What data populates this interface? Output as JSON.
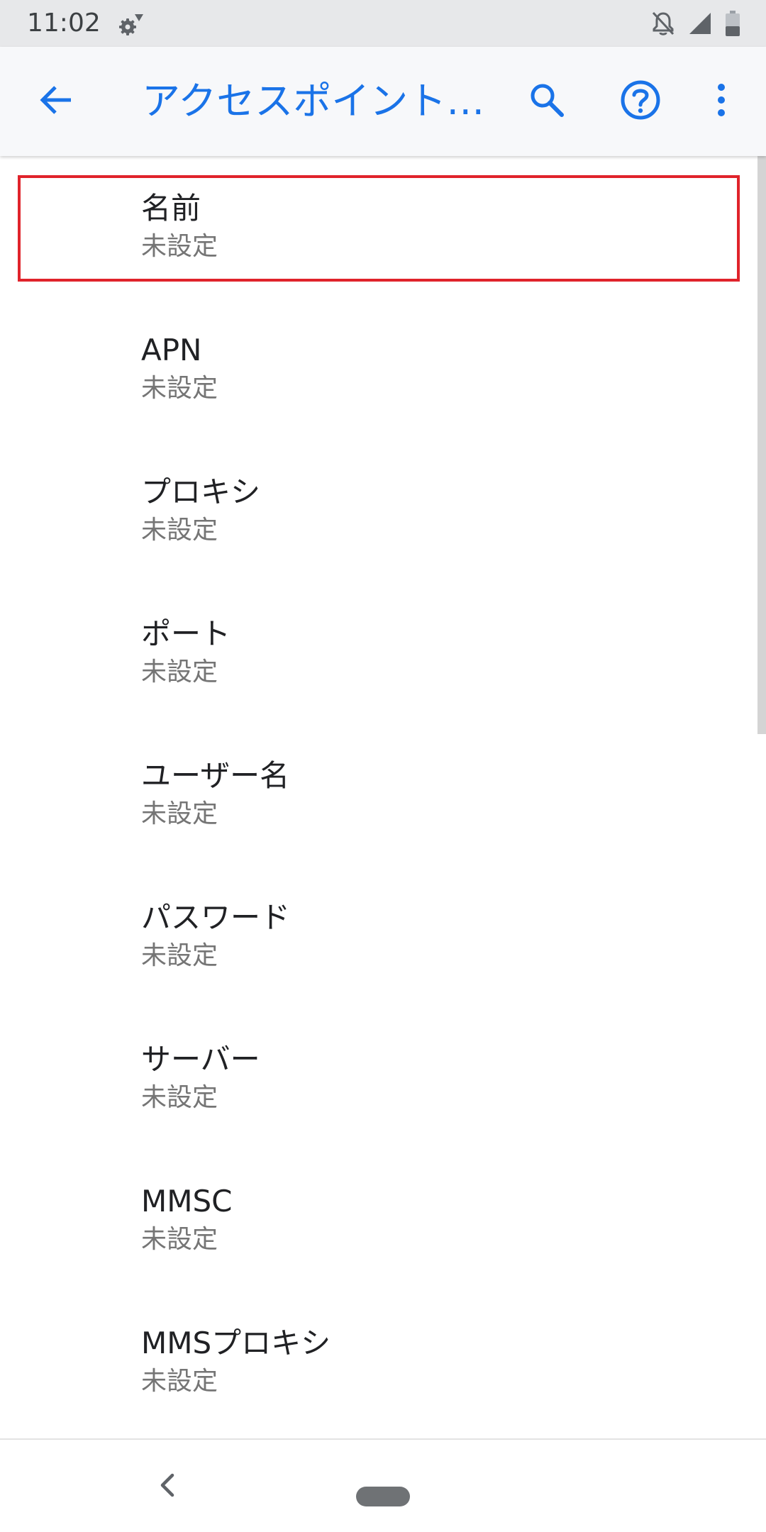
{
  "status_bar": {
    "time": "11:02",
    "icons": [
      "settings-gear-icon",
      "notifications-off-icon",
      "cell-signal-icon",
      "battery-icon"
    ]
  },
  "app_bar": {
    "title": "アクセスポイント…",
    "back_icon": "arrow-back-icon",
    "actions": [
      "search-icon",
      "help-icon",
      "more-vert-icon"
    ],
    "accent_color": "#1a73e8"
  },
  "list": {
    "items": [
      {
        "title": "名前",
        "summary": "未設定"
      },
      {
        "title": "APN",
        "summary": "未設定"
      },
      {
        "title": "プロキシ",
        "summary": "未設定"
      },
      {
        "title": "ポート",
        "summary": "未設定"
      },
      {
        "title": "ユーザー名",
        "summary": "未設定"
      },
      {
        "title": "パスワード",
        "summary": "未設定"
      },
      {
        "title": "サーバー",
        "summary": "未設定"
      },
      {
        "title": "MMSC",
        "summary": "未設定"
      },
      {
        "title": "MMSプロキシ",
        "summary": "未設定"
      }
    ],
    "highlighted_item": "名前",
    "highlight_color": "#e0232b"
  },
  "nav_bar": {
    "icons": [
      "nav-back-icon",
      "nav-home-pill-icon"
    ]
  }
}
